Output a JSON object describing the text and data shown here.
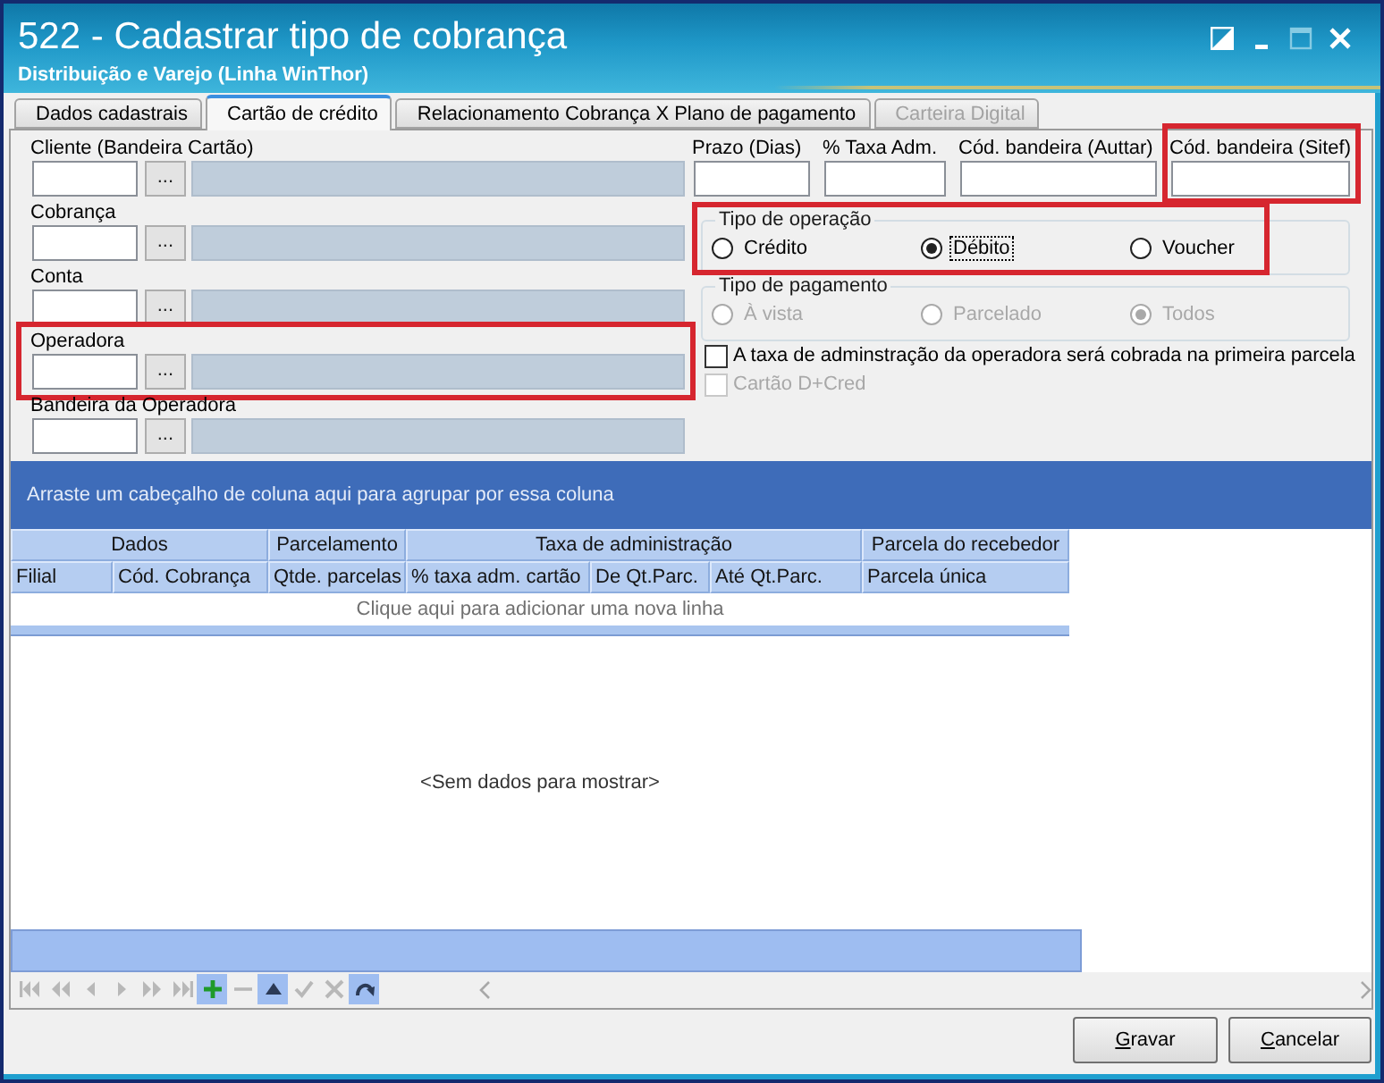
{
  "window": {
    "title": "522 - Cadastrar tipo de cobrança",
    "subtitle": "Distribuição e Varejo (Linha WinThor)",
    "controls": [
      {
        "kind": "restore",
        "disabled": false
      },
      {
        "kind": "minimize",
        "disabled": false
      },
      {
        "kind": "maximize",
        "disabled": true
      },
      {
        "kind": "close",
        "disabled": false
      }
    ]
  },
  "tabs": [
    {
      "label": "Dados cadastrais",
      "selected": false,
      "disabled": false
    },
    {
      "label": "Cartão de crédito",
      "selected": true,
      "disabled": false
    },
    {
      "label": "Relacionamento Cobrança X Plano de pagamento",
      "selected": false,
      "disabled": false
    },
    {
      "label": "Carteira Digital",
      "selected": false,
      "disabled": true
    }
  ],
  "lookup_fields": [
    {
      "label": "Cliente (Bandeira Cartão)",
      "button": "...",
      "highlighted": false
    },
    {
      "label": "Cobrança",
      "button": "...",
      "highlighted": false
    },
    {
      "label": "Conta",
      "button": "...",
      "highlighted": false
    },
    {
      "label": "Operadora",
      "button": "...",
      "highlighted": true
    },
    {
      "label": "Bandeira da Operadora",
      "button": "...",
      "highlighted": false
    }
  ],
  "code_fields": [
    {
      "label": "Prazo (Dias)",
      "highlighted": false
    },
    {
      "label": "% Taxa Adm.",
      "highlighted": false
    },
    {
      "label": "Cód. bandeira (Auttar)",
      "highlighted": false
    },
    {
      "label": "Cód. bandeira (Sitef)",
      "highlighted": true
    }
  ],
  "operation_type": {
    "legend": "Tipo de operação",
    "highlighted": true,
    "disabled": false,
    "options": [
      {
        "label": "Crédito",
        "selected": false,
        "focused": false
      },
      {
        "label": "Débito",
        "selected": true,
        "focused": true
      },
      {
        "label": "Voucher",
        "selected": false,
        "focused": false
      }
    ]
  },
  "payment_type": {
    "legend": "Tipo de pagamento",
    "highlighted": false,
    "disabled": true,
    "options": [
      {
        "label": "À vista",
        "selected": false,
        "focused": false
      },
      {
        "label": "Parcelado",
        "selected": false,
        "focused": false
      },
      {
        "label": "Todos",
        "selected": true,
        "focused": false
      }
    ]
  },
  "checkboxes": [
    {
      "label": "A taxa de adminstração da operadora será cobrada na primeira parcela",
      "checked": false,
      "disabled": false
    },
    {
      "label": "Cartão D+Cred",
      "checked": false,
      "disabled": true
    }
  ],
  "grid": {
    "group_panel": "Arraste um cabeçalho de coluna aqui para agrupar por essa coluna",
    "bands": [
      {
        "label": "Dados",
        "columns": [
          "Filial",
          "Cód. Cobrança"
        ]
      },
      {
        "label": "Parcelamento",
        "columns": [
          "Qtde. parcelas"
        ]
      },
      {
        "label": "Taxa de administração",
        "columns": [
          "% taxa adm. cartão",
          "De Qt.Parc.",
          "Até Qt.Parc."
        ]
      },
      {
        "label": "Parcela do recebedor",
        "columns": [
          "Parcela única"
        ]
      }
    ],
    "new_row": "Clique aqui para adicionar uma nova linha",
    "empty_text": "<Sem dados para mostrar>",
    "navigator": [
      {
        "kind": "first",
        "disabled": true
      },
      {
        "kind": "prev_page",
        "disabled": true
      },
      {
        "kind": "prev",
        "disabled": true
      },
      {
        "kind": "next",
        "disabled": true
      },
      {
        "kind": "next_page",
        "disabled": true
      },
      {
        "kind": "last",
        "disabled": true
      },
      {
        "kind": "insert",
        "disabled": false
      },
      {
        "kind": "delete",
        "disabled": true
      },
      {
        "kind": "edit",
        "disabled": false
      },
      {
        "kind": "post",
        "disabled": true
      },
      {
        "kind": "cancel",
        "disabled": true
      },
      {
        "kind": "refresh",
        "disabled": false
      }
    ]
  },
  "buttons": [
    {
      "label": "Gravar"
    },
    {
      "label": "Cancelar"
    }
  ]
}
